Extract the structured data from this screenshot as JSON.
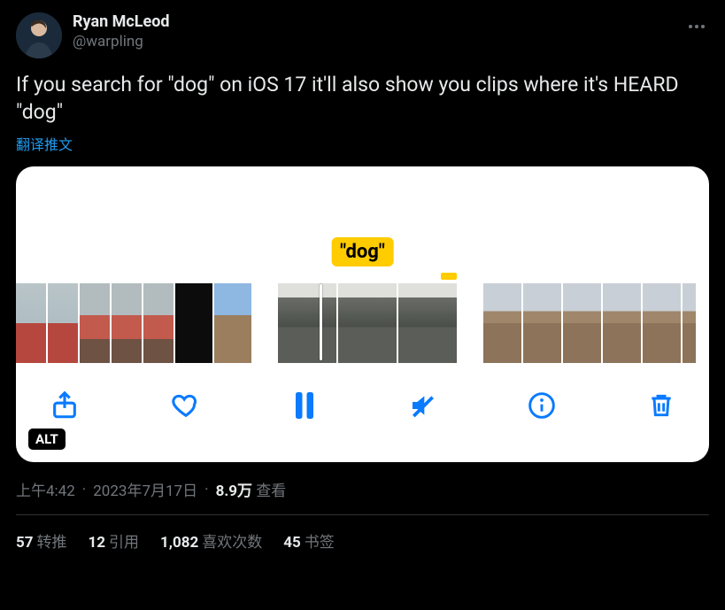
{
  "author": {
    "display_name": "Ryan McLeod",
    "handle": "@warpling"
  },
  "body_text": "If you search for \"dog\" on iOS 17 it'll also show you clips where it's HEARD \"dog\"",
  "translate_label": "翻译推文",
  "media": {
    "caption_text": "\"dog\"",
    "alt_badge": "ALT"
  },
  "meta": {
    "time": "上午4:42",
    "date": "2023年7月17日",
    "views_count": "8.9万",
    "views_label": "查看"
  },
  "stats": {
    "retweets_count": "57",
    "retweets_label": "转推",
    "quotes_count": "12",
    "quotes_label": "引用",
    "likes_count": "1,082",
    "likes_label": "喜欢次数",
    "bookmarks_count": "45",
    "bookmarks_label": "书签"
  }
}
